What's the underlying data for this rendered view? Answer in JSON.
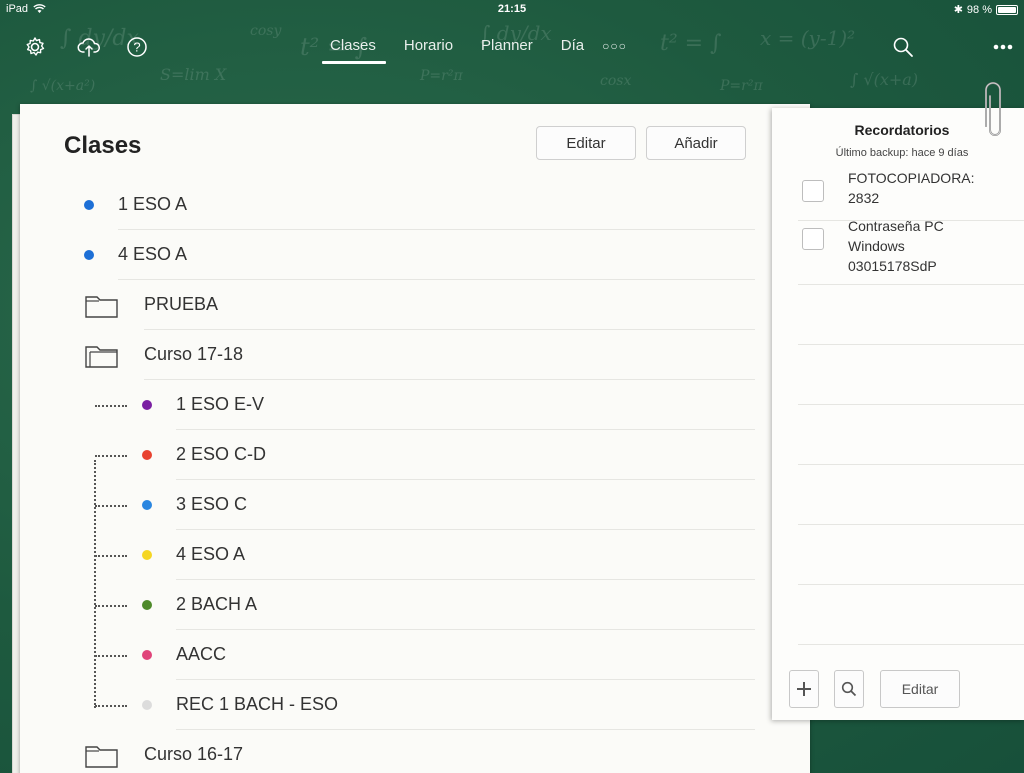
{
  "status_bar": {
    "device": "iPad",
    "time": "21:15",
    "battery": "98 %",
    "battery_level": 0.98
  },
  "nav": {
    "settings_icon": "gear-icon",
    "upload_icon": "cloud-upload-icon",
    "help_icon": "question-icon",
    "tabs": [
      {
        "label": "Clases",
        "active": true
      },
      {
        "label": "Horario",
        "active": false
      },
      {
        "label": "Planner",
        "active": false
      },
      {
        "label": "Día",
        "active": false
      }
    ],
    "more_tabs": "○○○",
    "search_icon": "search-icon",
    "menu_icon": "more-icon"
  },
  "main": {
    "title": "Clases",
    "edit_label": "Editar",
    "add_label": "Añadir",
    "items": [
      {
        "type": "class",
        "label": "1 ESO A",
        "color": "#1d6fd6",
        "level": 0
      },
      {
        "type": "class",
        "label": "4 ESO A",
        "color": "#1d6fd6",
        "level": 0
      },
      {
        "type": "folder",
        "label": "PRUEBA",
        "open": false,
        "level": 0
      },
      {
        "type": "folder",
        "label": "Curso 17-18",
        "open": true,
        "level": 0
      },
      {
        "type": "class",
        "label": "1 ESO E-V",
        "color": "#7a1fa2",
        "level": 1
      },
      {
        "type": "class",
        "label": "2 ESO C-D",
        "color": "#e8422f",
        "level": 1
      },
      {
        "type": "class",
        "label": "3 ESO C",
        "color": "#2a86e0",
        "level": 1
      },
      {
        "type": "class",
        "label": "4 ESO A",
        "color": "#f5d623",
        "level": 1
      },
      {
        "type": "class",
        "label": "2 BACH A",
        "color": "#4e8a2a",
        "level": 1
      },
      {
        "type": "class",
        "label": "AACC",
        "color": "#e0447a",
        "level": 1
      },
      {
        "type": "class",
        "label": "REC 1 BACH  - ESO",
        "color": "#dcdcdc",
        "level": 1
      },
      {
        "type": "folder",
        "label": "Curso 16-17",
        "open": false,
        "level": 0
      }
    ]
  },
  "reminders": {
    "title": "Recordatorios",
    "backup": "Último backup: hace 9 días",
    "items": [
      {
        "text": "FOTOCOPIADORA:\n2832",
        "done": false
      },
      {
        "text": "Contraseña PC\nWindows\n03015178SdP",
        "done": false
      }
    ],
    "add_icon": "plus-icon",
    "search_icon": "search-icon",
    "edit_label": "Editar"
  }
}
